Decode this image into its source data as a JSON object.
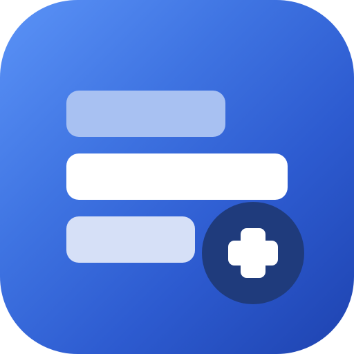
{
  "app_icon": {
    "icon_name": "list-add-icon",
    "colors": {
      "background_top": "#5b93f7",
      "background_bottom": "#1e43b0",
      "bar_top": "#a8c1f2",
      "bar_middle": "#ffffff",
      "bar_bottom": "#d6e0f7",
      "badge": "#1f3b7c",
      "plus": "#ffffff"
    },
    "bars": [
      "bar-top",
      "bar-middle",
      "bar-bottom"
    ],
    "badge_icon": "plus-icon"
  }
}
